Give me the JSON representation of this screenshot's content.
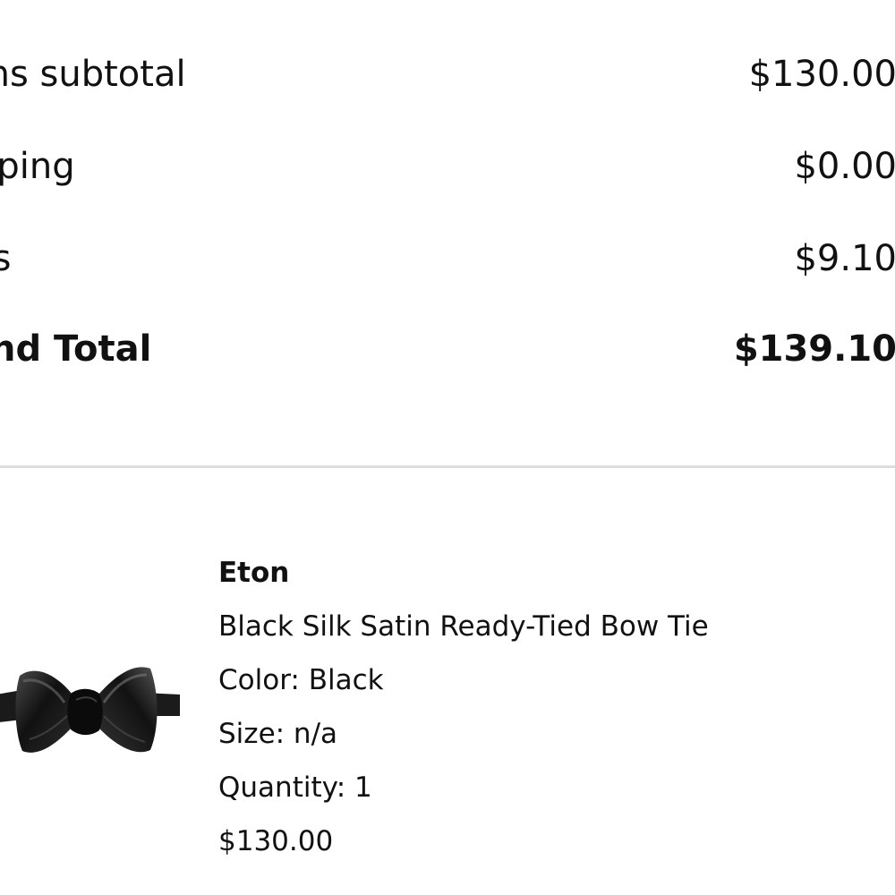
{
  "summary": {
    "rows": [
      {
        "label": "ms subtotal",
        "value": "$130.00"
      },
      {
        "label": "pping",
        "value": "$0.00"
      },
      {
        "label": "es",
        "value": "$9.10"
      },
      {
        "label": "and Total",
        "value": "$139.10"
      }
    ]
  },
  "product": {
    "brand": "Eton",
    "name": "Black Silk Satin Ready-Tied Bow Tie",
    "color": "Color: Black",
    "size": "Size: n/a",
    "quantity": "Quantity: 1",
    "price": "$130.00",
    "image_icon": "bow-tie-icon"
  },
  "colors": {
    "text": "#111111",
    "divider": "#dddddd",
    "background": "#ffffff"
  }
}
